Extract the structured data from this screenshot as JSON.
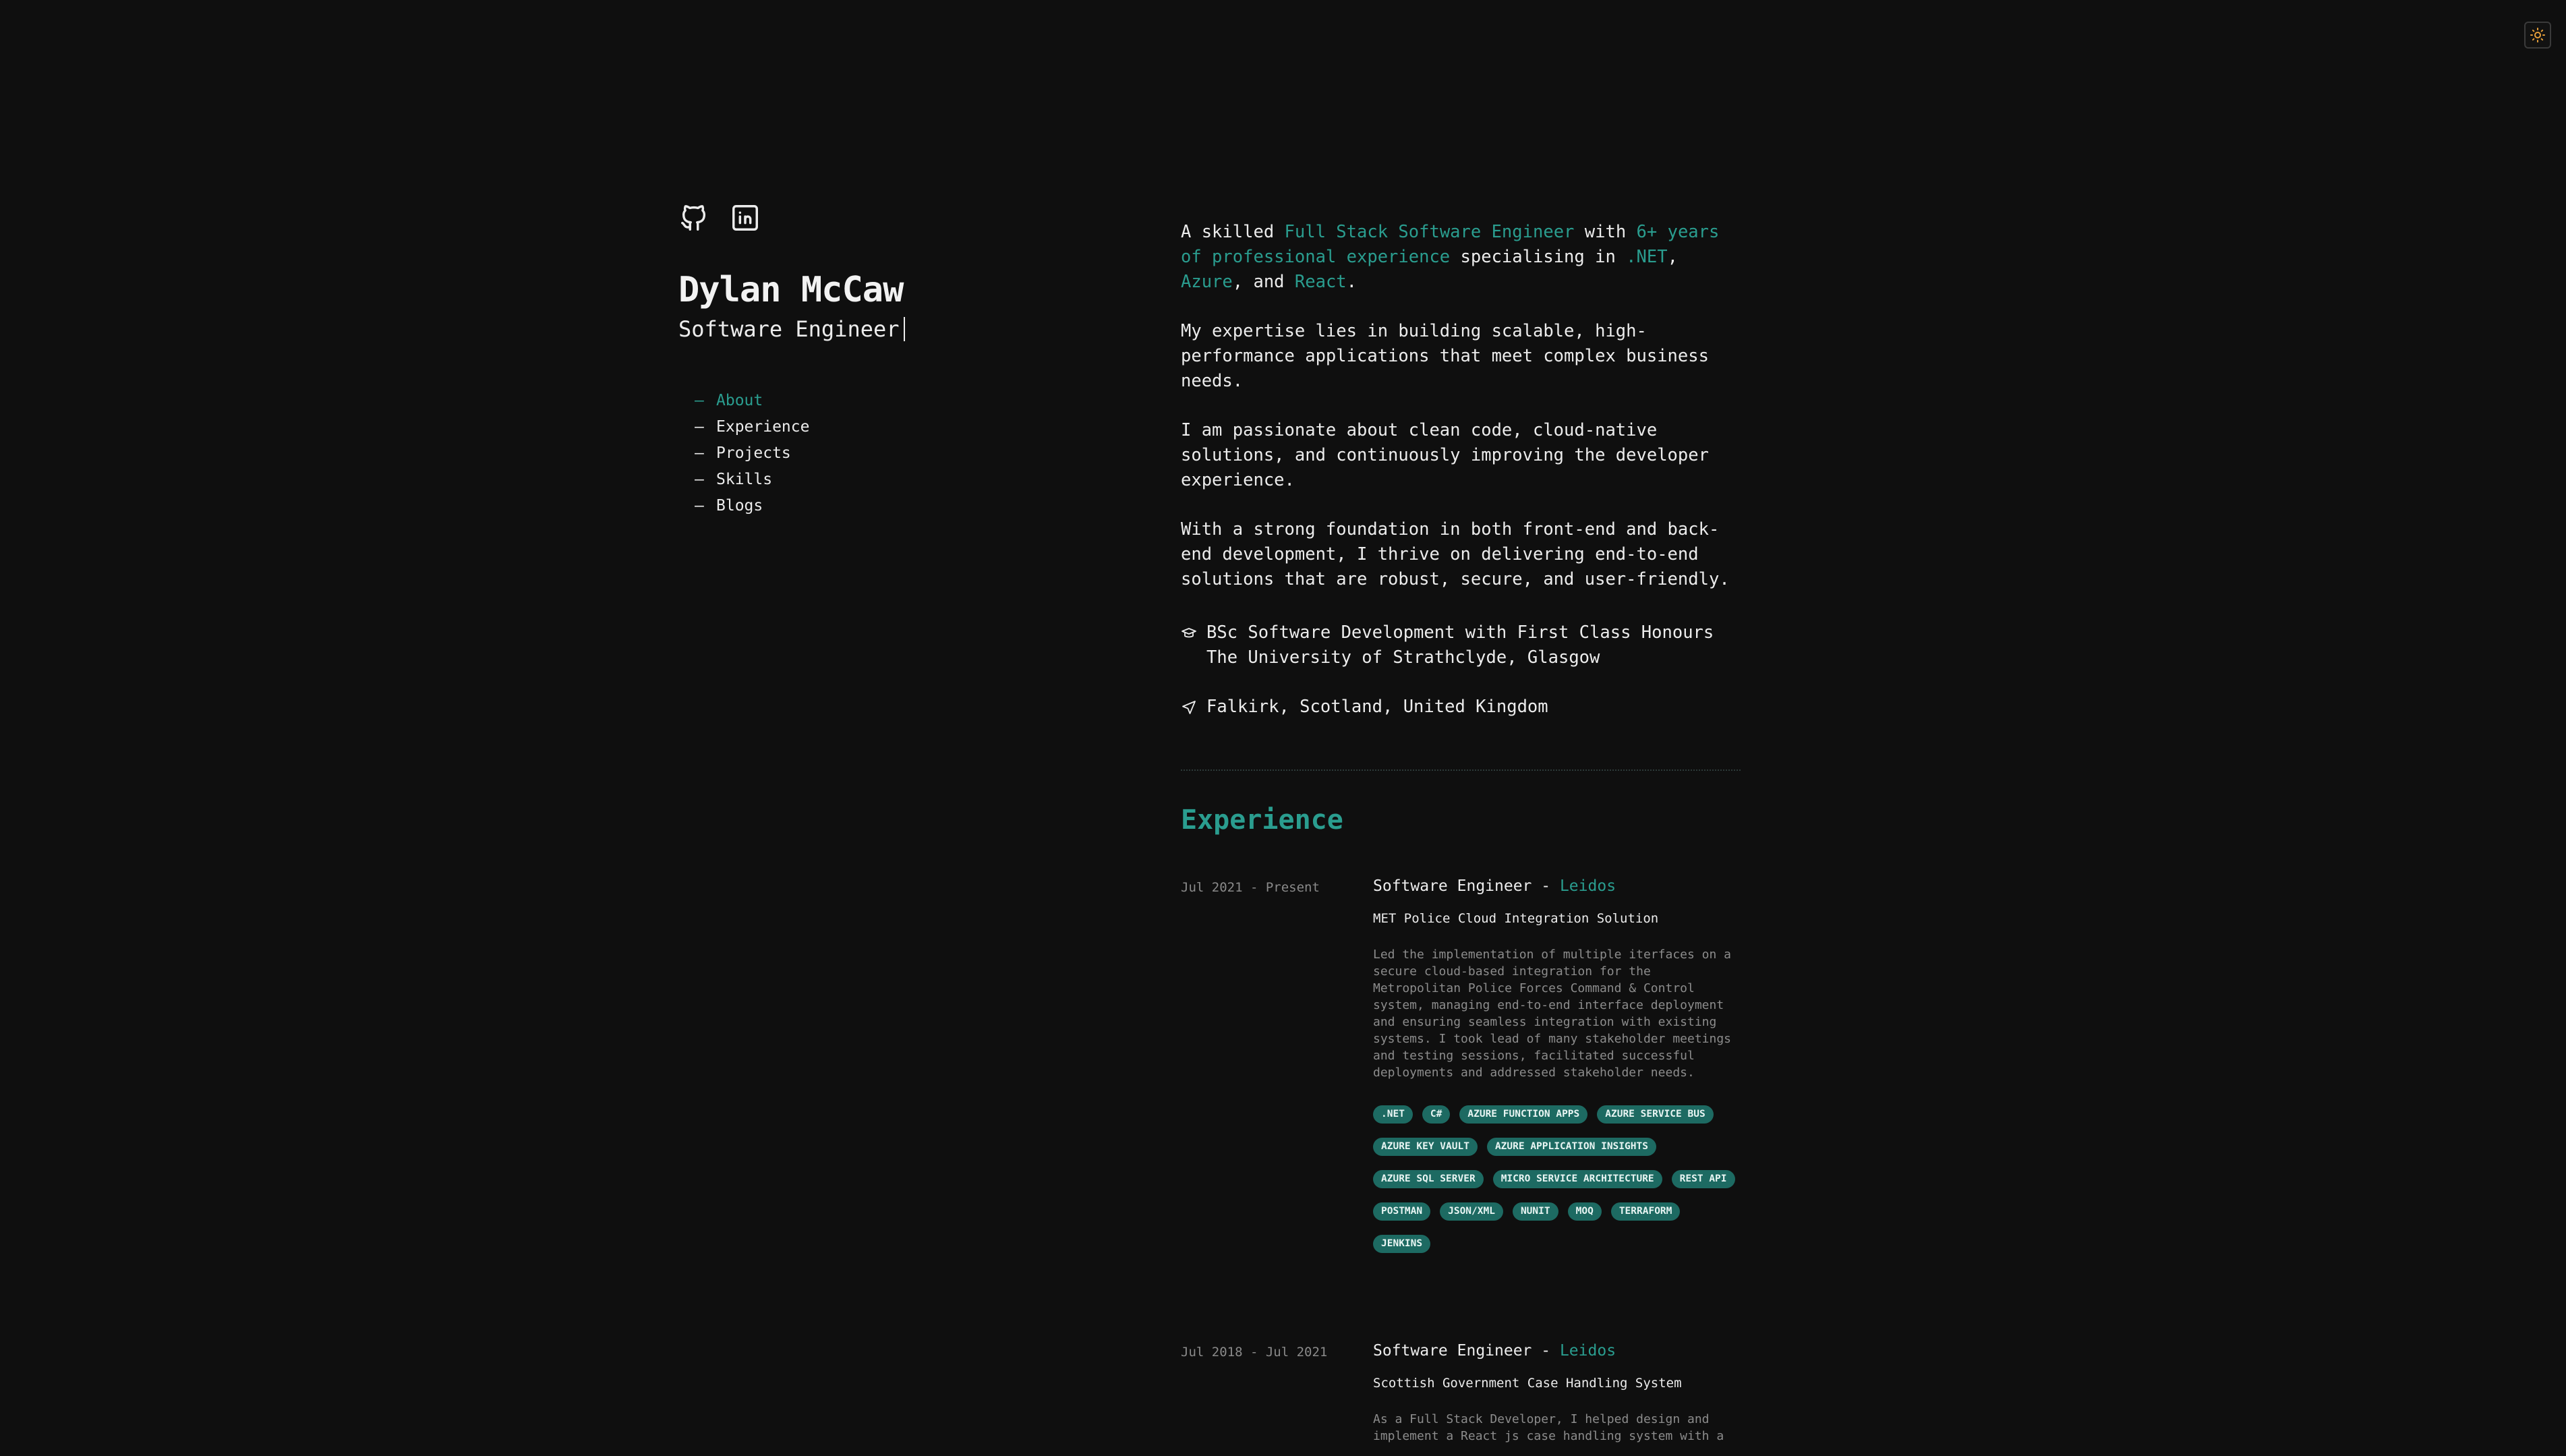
{
  "theme_toggle": {
    "icon": "sun-icon",
    "accent": "#e8a03a"
  },
  "profile": {
    "name": "Dylan McCaw",
    "role": "Software Engineer",
    "socials": [
      {
        "icon": "github-icon"
      },
      {
        "icon": "linkedin-icon"
      }
    ]
  },
  "nav": {
    "items": [
      {
        "dash": "—",
        "label": "About"
      },
      {
        "dash": "—",
        "label": "Experience"
      },
      {
        "dash": "—",
        "label": "Projects"
      },
      {
        "dash": "—",
        "label": "Skills"
      },
      {
        "dash": "—",
        "label": "Blogs"
      }
    ],
    "active_color": "#2a9d8f"
  },
  "about": {
    "p1": {
      "t1": "A skilled ",
      "h1": "Full Stack Software Engineer",
      "t2": " with ",
      "h2": "6+ years of professional experience",
      "t3": " specialising in ",
      "h3": ".NET",
      "t4": ", ",
      "h4": "Azure",
      "t5": ", and ",
      "h5": "React",
      "t6": "."
    },
    "p2": "My expertise lies in building scalable, high-performance applications that meet complex business needs.",
    "p3": "I am passionate about clean code, cloud-native solutions, and continuously improving the developer experience.",
    "p4": "With a strong foundation in both front-end and back-end development, I thrive on delivering end-to-end solutions that are robust, secure, and user-friendly.",
    "education_line1": "BSc Software Development with First Class Honours",
    "education_line2": "The University of Strathclyde, Glasgow",
    "location": "Falkirk, Scotland, United Kingdom"
  },
  "experience": {
    "title": "Experience",
    "jobs": [
      {
        "date": "Jul 2021 - Present",
        "title": "Software Engineer",
        "sep": " - ",
        "company": "Leidos",
        "project": "MET Police Cloud Integration Solution",
        "description": "Led the implementation of multiple iterfaces on a secure cloud-based integration for the Metropolitan Police Forces Command & Control system, managing end-to-end interface deployment and ensuring seamless integration with existing systems. I took lead of many stakeholder meetings and testing sessions, facilitated successful deployments and addressed stakeholder needs.",
        "tags": [
          ".NET",
          "C#",
          "AZURE FUNCTION APPS",
          "AZURE SERVICE BUS",
          "AZURE KEY VAULT",
          "AZURE APPLICATION INSIGHTS",
          "AZURE SQL SERVER",
          "MICRO SERVICE ARCHITECTURE",
          "REST API",
          "POSTMAN",
          "JSON/XML",
          "NUNIT",
          "MOQ",
          "TERRAFORM",
          "JENKINS"
        ]
      },
      {
        "date": "Jul 2018 - Jul 2021",
        "title": "Software Engineer",
        "sep": " - ",
        "company": "Leidos",
        "project": "Scottish Government Case Handling System",
        "description": "As a Full Stack Developer, I helped design and implement a React js case handling system with a"
      }
    ]
  }
}
